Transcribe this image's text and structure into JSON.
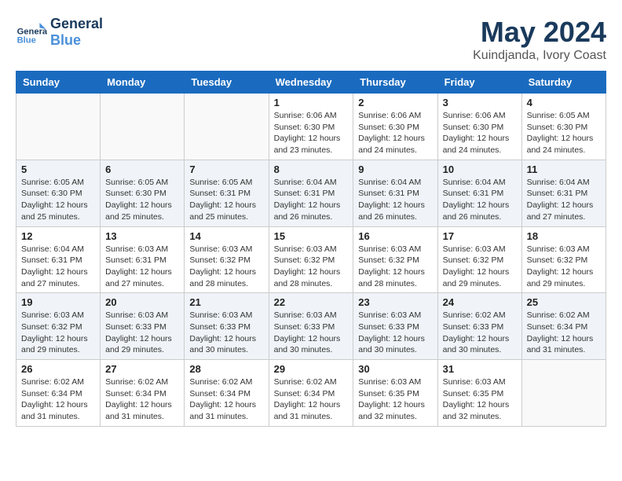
{
  "header": {
    "logo_line1": "General",
    "logo_line2": "Blue",
    "month_year": "May 2024",
    "location": "Kuindjanda, Ivory Coast"
  },
  "weekdays": [
    "Sunday",
    "Monday",
    "Tuesday",
    "Wednesday",
    "Thursday",
    "Friday",
    "Saturday"
  ],
  "weeks": [
    [
      {
        "day": "",
        "info": ""
      },
      {
        "day": "",
        "info": ""
      },
      {
        "day": "",
        "info": ""
      },
      {
        "day": "1",
        "info": "Sunrise: 6:06 AM\nSunset: 6:30 PM\nDaylight: 12 hours\nand 23 minutes."
      },
      {
        "day": "2",
        "info": "Sunrise: 6:06 AM\nSunset: 6:30 PM\nDaylight: 12 hours\nand 24 minutes."
      },
      {
        "day": "3",
        "info": "Sunrise: 6:06 AM\nSunset: 6:30 PM\nDaylight: 12 hours\nand 24 minutes."
      },
      {
        "day": "4",
        "info": "Sunrise: 6:05 AM\nSunset: 6:30 PM\nDaylight: 12 hours\nand 24 minutes."
      }
    ],
    [
      {
        "day": "5",
        "info": "Sunrise: 6:05 AM\nSunset: 6:30 PM\nDaylight: 12 hours\nand 25 minutes."
      },
      {
        "day": "6",
        "info": "Sunrise: 6:05 AM\nSunset: 6:30 PM\nDaylight: 12 hours\nand 25 minutes."
      },
      {
        "day": "7",
        "info": "Sunrise: 6:05 AM\nSunset: 6:31 PM\nDaylight: 12 hours\nand 25 minutes."
      },
      {
        "day": "8",
        "info": "Sunrise: 6:04 AM\nSunset: 6:31 PM\nDaylight: 12 hours\nand 26 minutes."
      },
      {
        "day": "9",
        "info": "Sunrise: 6:04 AM\nSunset: 6:31 PM\nDaylight: 12 hours\nand 26 minutes."
      },
      {
        "day": "10",
        "info": "Sunrise: 6:04 AM\nSunset: 6:31 PM\nDaylight: 12 hours\nand 26 minutes."
      },
      {
        "day": "11",
        "info": "Sunrise: 6:04 AM\nSunset: 6:31 PM\nDaylight: 12 hours\nand 27 minutes."
      }
    ],
    [
      {
        "day": "12",
        "info": "Sunrise: 6:04 AM\nSunset: 6:31 PM\nDaylight: 12 hours\nand 27 minutes."
      },
      {
        "day": "13",
        "info": "Sunrise: 6:03 AM\nSunset: 6:31 PM\nDaylight: 12 hours\nand 27 minutes."
      },
      {
        "day": "14",
        "info": "Sunrise: 6:03 AM\nSunset: 6:32 PM\nDaylight: 12 hours\nand 28 minutes."
      },
      {
        "day": "15",
        "info": "Sunrise: 6:03 AM\nSunset: 6:32 PM\nDaylight: 12 hours\nand 28 minutes."
      },
      {
        "day": "16",
        "info": "Sunrise: 6:03 AM\nSunset: 6:32 PM\nDaylight: 12 hours\nand 28 minutes."
      },
      {
        "day": "17",
        "info": "Sunrise: 6:03 AM\nSunset: 6:32 PM\nDaylight: 12 hours\nand 29 minutes."
      },
      {
        "day": "18",
        "info": "Sunrise: 6:03 AM\nSunset: 6:32 PM\nDaylight: 12 hours\nand 29 minutes."
      }
    ],
    [
      {
        "day": "19",
        "info": "Sunrise: 6:03 AM\nSunset: 6:32 PM\nDaylight: 12 hours\nand 29 minutes."
      },
      {
        "day": "20",
        "info": "Sunrise: 6:03 AM\nSunset: 6:33 PM\nDaylight: 12 hours\nand 29 minutes."
      },
      {
        "day": "21",
        "info": "Sunrise: 6:03 AM\nSunset: 6:33 PM\nDaylight: 12 hours\nand 30 minutes."
      },
      {
        "day": "22",
        "info": "Sunrise: 6:03 AM\nSunset: 6:33 PM\nDaylight: 12 hours\nand 30 minutes."
      },
      {
        "day": "23",
        "info": "Sunrise: 6:03 AM\nSunset: 6:33 PM\nDaylight: 12 hours\nand 30 minutes."
      },
      {
        "day": "24",
        "info": "Sunrise: 6:02 AM\nSunset: 6:33 PM\nDaylight: 12 hours\nand 30 minutes."
      },
      {
        "day": "25",
        "info": "Sunrise: 6:02 AM\nSunset: 6:34 PM\nDaylight: 12 hours\nand 31 minutes."
      }
    ],
    [
      {
        "day": "26",
        "info": "Sunrise: 6:02 AM\nSunset: 6:34 PM\nDaylight: 12 hours\nand 31 minutes."
      },
      {
        "day": "27",
        "info": "Sunrise: 6:02 AM\nSunset: 6:34 PM\nDaylight: 12 hours\nand 31 minutes."
      },
      {
        "day": "28",
        "info": "Sunrise: 6:02 AM\nSunset: 6:34 PM\nDaylight: 12 hours\nand 31 minutes."
      },
      {
        "day": "29",
        "info": "Sunrise: 6:02 AM\nSunset: 6:34 PM\nDaylight: 12 hours\nand 31 minutes."
      },
      {
        "day": "30",
        "info": "Sunrise: 6:03 AM\nSunset: 6:35 PM\nDaylight: 12 hours\nand 32 minutes."
      },
      {
        "day": "31",
        "info": "Sunrise: 6:03 AM\nSunset: 6:35 PM\nDaylight: 12 hours\nand 32 minutes."
      },
      {
        "day": "",
        "info": ""
      }
    ]
  ]
}
